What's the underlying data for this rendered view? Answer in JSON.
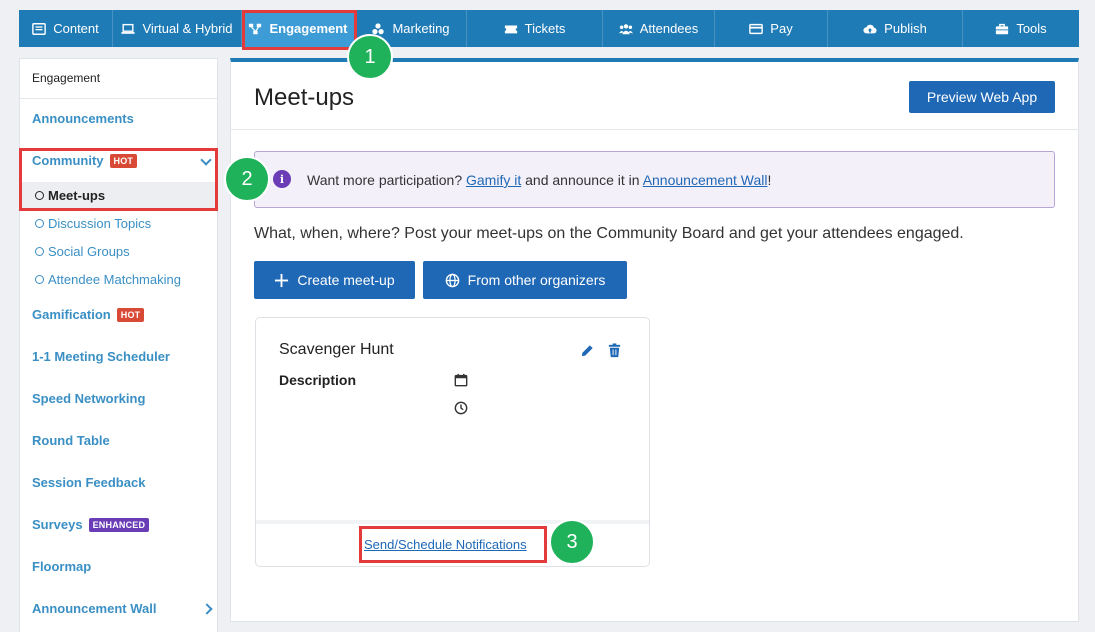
{
  "topnav": {
    "tabs": [
      {
        "label": "Content",
        "icon": "content-icon"
      },
      {
        "label": "Virtual & Hybrid",
        "icon": "laptop-icon"
      },
      {
        "label": "Engagement",
        "icon": "engagement-icon",
        "active": true
      },
      {
        "label": "Marketing",
        "icon": "marketing-icon"
      },
      {
        "label": "Tickets",
        "icon": "ticket-icon"
      },
      {
        "label": "Attendees",
        "icon": "attendees-icon"
      },
      {
        "label": "Pay",
        "icon": "card-icon"
      },
      {
        "label": "Publish",
        "icon": "cloud-upload-icon"
      },
      {
        "label": "Tools",
        "icon": "toolbox-icon"
      }
    ]
  },
  "sidebar": {
    "header": "Engagement",
    "items": [
      {
        "label": "Announcements"
      },
      {
        "label": "Community",
        "badge": "HOT",
        "expanded": true
      },
      {
        "label": "Gamification",
        "badge": "HOT"
      },
      {
        "label": "1-1 Meeting Scheduler"
      },
      {
        "label": "Speed Networking"
      },
      {
        "label": "Round Table"
      },
      {
        "label": "Session Feedback"
      },
      {
        "label": "Surveys",
        "badge": "ENHANCED"
      },
      {
        "label": "Floormap"
      },
      {
        "label": "Announcement Wall"
      }
    ],
    "community_sub": [
      {
        "label": "Meet-ups",
        "active": true
      },
      {
        "label": "Discussion Topics"
      },
      {
        "label": "Social Groups"
      },
      {
        "label": "Attendee Matchmaking"
      }
    ]
  },
  "main": {
    "title": "Meet-ups",
    "preview_button": "Preview Web App",
    "info": {
      "prefix": "Want more participation?",
      "link1": "Gamify it",
      "middle": "and announce it in",
      "link2": "Announcement Wall",
      "suffix": "!"
    },
    "description": "What, when, where? Post your meet-ups on the Community Board and get your attendees engaged.",
    "create_button": "Create meet-up",
    "other_button": "From other organizers",
    "card": {
      "title": "Scavenger Hunt",
      "description_label": "Description",
      "notifications_link": "Send/Schedule Notifications"
    }
  },
  "annotations": {
    "steps": [
      "1",
      "2",
      "3"
    ],
    "highlight_color": "#e33b3b",
    "step_color": "#1fb25a"
  },
  "colors": {
    "nav_bg": "#1f7bb6",
    "nav_active": "#3d9bd6",
    "primary_button": "#1f68b6",
    "hot_badge": "#d84a35",
    "enhanced_badge": "#6a3cb6"
  }
}
